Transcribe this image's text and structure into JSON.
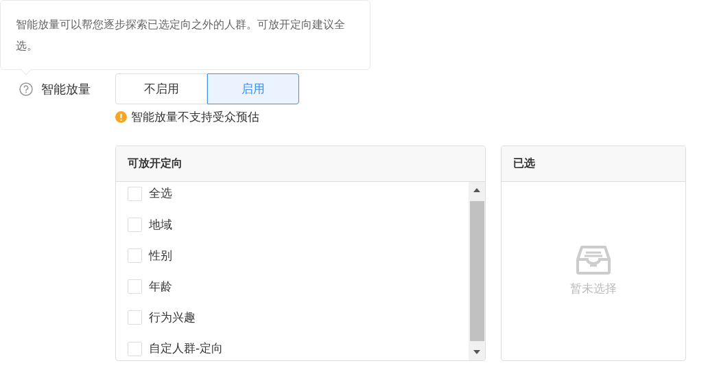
{
  "tooltip": {
    "text": "智能放量可以帮您逐步探索已选定向之外的人群。可放开定向建议全选。"
  },
  "field": {
    "label": "智能放量",
    "options": [
      {
        "label": "不启用",
        "selected": false
      },
      {
        "label": "启用",
        "selected": true
      }
    ],
    "warning": "智能放量不支持受众预估"
  },
  "available": {
    "title": "可放开定向",
    "items": [
      {
        "label": "全选",
        "checked": false
      },
      {
        "label": "地域",
        "checked": false
      },
      {
        "label": "性别",
        "checked": false
      },
      {
        "label": "年龄",
        "checked": false
      },
      {
        "label": "行为兴趣",
        "checked": false
      },
      {
        "label": "自定人群-定向",
        "checked": false
      }
    ]
  },
  "selected_panel": {
    "title": "已选",
    "empty_text": "暂未选择"
  }
}
